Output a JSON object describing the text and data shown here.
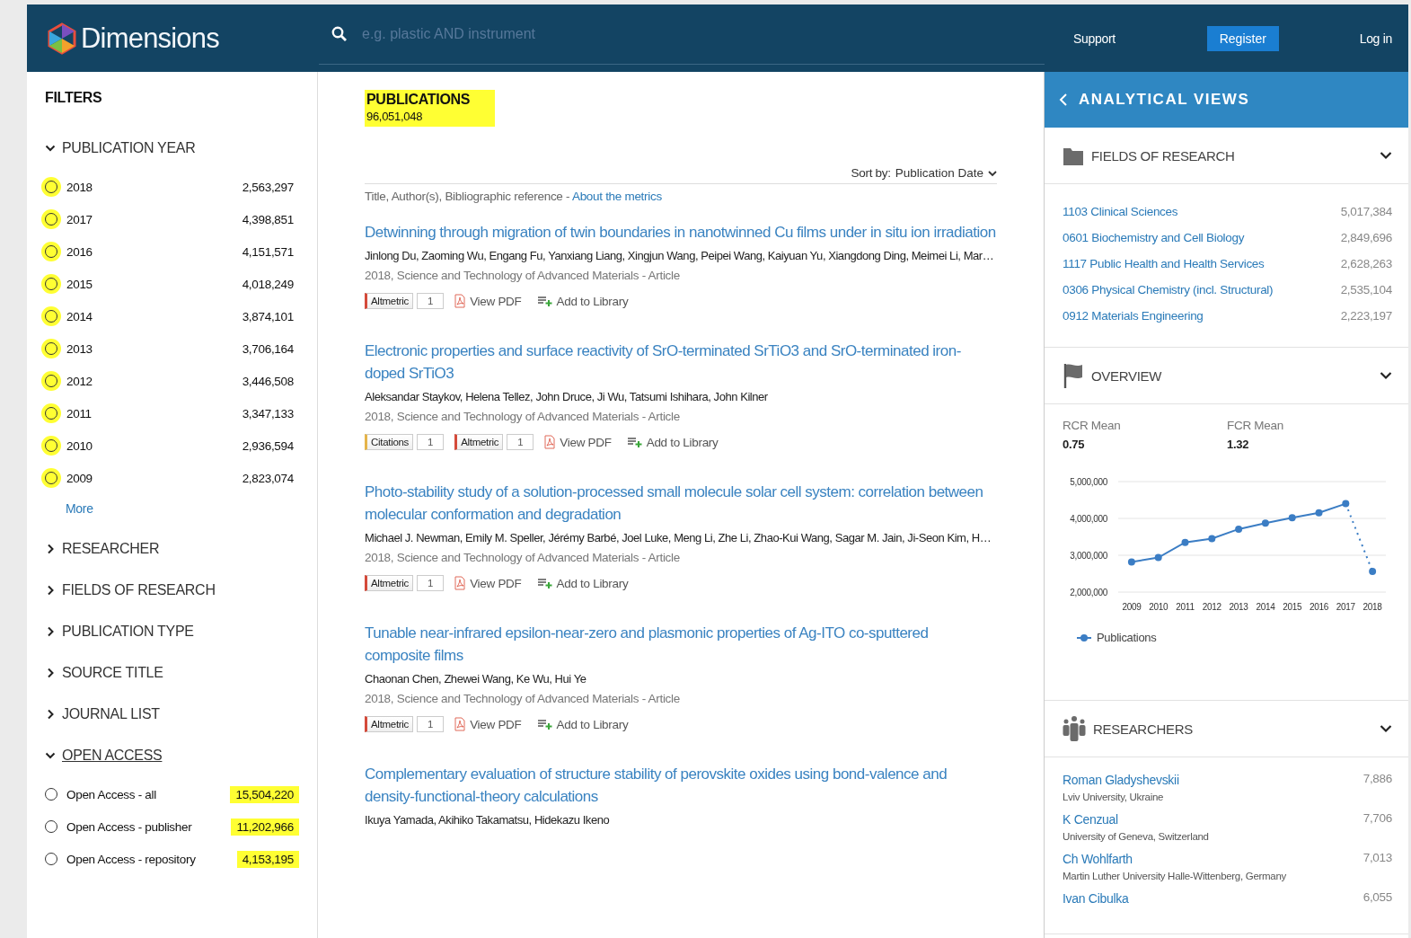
{
  "header": {
    "logo": "Dimensions",
    "search": {
      "placeholder": "e.g. plastic AND instrument"
    },
    "links": [
      {
        "label": "Support",
        "kind": "link"
      },
      {
        "label": "Register",
        "kind": "button"
      },
      {
        "label": "Log in",
        "kind": "link"
      }
    ]
  },
  "filters": {
    "title": "FILTERS",
    "sections": [
      {
        "label": "PUBLICATION YEAR",
        "expanded": true,
        "hovered": false,
        "more": "More",
        "options": [
          {
            "label": "2018",
            "count": "2,563,297",
            "selected": false,
            "radio_highlighted": true,
            "count_highlighted": false
          },
          {
            "label": "2017",
            "count": "4,398,851",
            "selected": false,
            "radio_highlighted": true,
            "count_highlighted": false
          },
          {
            "label": "2016",
            "count": "4,151,571",
            "selected": false,
            "radio_highlighted": true,
            "count_highlighted": false
          },
          {
            "label": "2015",
            "count": "4,018,249",
            "selected": false,
            "radio_highlighted": true,
            "count_highlighted": false
          },
          {
            "label": "2014",
            "count": "3,874,101",
            "selected": false,
            "radio_highlighted": true,
            "count_highlighted": false
          },
          {
            "label": "2013",
            "count": "3,706,164",
            "selected": false,
            "radio_highlighted": true,
            "count_highlighted": false
          },
          {
            "label": "2012",
            "count": "3,446,508",
            "selected": false,
            "radio_highlighted": true,
            "count_highlighted": false
          },
          {
            "label": "2011",
            "count": "3,347,133",
            "selected": false,
            "radio_highlighted": true,
            "count_highlighted": false
          },
          {
            "label": "2010",
            "count": "2,936,594",
            "selected": false,
            "radio_highlighted": true,
            "count_highlighted": false
          },
          {
            "label": "2009",
            "count": "2,823,074",
            "selected": false,
            "radio_highlighted": true,
            "count_highlighted": false
          }
        ]
      },
      {
        "label": "RESEARCHER",
        "expanded": false,
        "hovered": false
      },
      {
        "label": "FIELDS OF RESEARCH",
        "expanded": false,
        "hovered": false
      },
      {
        "label": "PUBLICATION TYPE",
        "expanded": false,
        "hovered": false
      },
      {
        "label": "SOURCE TITLE",
        "expanded": false,
        "hovered": false
      },
      {
        "label": "JOURNAL LIST",
        "expanded": false,
        "hovered": false
      },
      {
        "label": "OPEN ACCESS",
        "expanded": true,
        "hovered": true,
        "options": [
          {
            "label": "Open Access - all",
            "count": "15,504,220",
            "selected": false,
            "radio_highlighted": false,
            "count_highlighted": true
          },
          {
            "label": "Open Access - publisher",
            "count": "11,202,966",
            "selected": false,
            "radio_highlighted": false,
            "count_highlighted": true
          },
          {
            "label": "Open Access - repository",
            "count": "4,153,195",
            "selected": false,
            "radio_highlighted": false,
            "count_highlighted": true
          }
        ]
      }
    ]
  },
  "results": {
    "title": "PUBLICATIONS",
    "count": "96,051,048",
    "highlighted": true,
    "sort_label": "Sort by:",
    "sort_value": "Publication Date",
    "columns_note": "Title, Author(s), Bibliographic reference - ",
    "metrics_link": "About the metrics",
    "items": [
      {
        "title": "Detwinning through migration of twin boundaries in nanotwinned Cu films under in situ ion irradiation",
        "authors": "Jinlong Du, Zaoming Wu, Engang Fu, Yanxiang Liang, Xingjun Wang, Peipei Wang, Kaiyuan Yu, Xiangdong Ding, Meimei Li, Mar…",
        "meta": "2018, Science and Technology of Advanced Materials - Article",
        "metrics": [
          {
            "kind": "altmetric",
            "label": "Altmetric",
            "count": "1"
          }
        ],
        "pdf": "View PDF",
        "library": "Add to Library"
      },
      {
        "title": "Electronic properties and surface reactivity of SrO-terminated SrTiO3 and SrO-terminated iron-doped SrTiO3",
        "authors": "Aleksandar Staykov, Helena Tellez, John Druce, Ji Wu, Tatsumi Ishihara, John Kilner",
        "meta": "2018, Science and Technology of Advanced Materials - Article",
        "metrics": [
          {
            "kind": "citations",
            "label": "Citations",
            "count": "1"
          },
          {
            "kind": "altmetric",
            "label": "Altmetric",
            "count": "1"
          }
        ],
        "pdf": "View PDF",
        "library": "Add to Library"
      },
      {
        "title": "Photo-stability study of a solution-processed small molecule solar cell system: correlation between molecular conformation and degradation",
        "authors": "Michael J. Newman, Emily M. Speller, Jérémy Barbé, Joel Luke, Meng Li, Zhe Li, Zhao-Kui Wang, Sagar M. Jain, Ji-Seon Kim, H…",
        "meta": "2018, Science and Technology of Advanced Materials - Article",
        "metrics": [
          {
            "kind": "altmetric",
            "label": "Altmetric",
            "count": "1"
          }
        ],
        "pdf": "View PDF",
        "library": "Add to Library"
      },
      {
        "title": "Tunable near-infrared epsilon-near-zero and plasmonic properties of Ag-ITO co-sputtered composite films",
        "authors": "Chaonan Chen, Zhewei Wang, Ke Wu, Hui Ye",
        "meta": "2018, Science and Technology of Advanced Materials - Article",
        "metrics": [
          {
            "kind": "altmetric",
            "label": "Altmetric",
            "count": "1"
          }
        ],
        "pdf": "View PDF",
        "library": "Add to Library"
      },
      {
        "title": "Complementary evaluation of structure stability of perovskite oxides using bond-valence and density-functional-theory calculations",
        "authors": "Ikuya Yamada, Akihiko Takamatsu, Hidekazu Ikeno"
      }
    ]
  },
  "analytics": {
    "title": "ANALYTICAL VIEWS",
    "panels": [
      {
        "kind": "fields",
        "title": "FIELDS OF RESEARCH",
        "rows": [
          {
            "label": "1103 Clinical Sciences",
            "count": "5,017,384"
          },
          {
            "label": "0601 Biochemistry and Cell Biology",
            "count": "2,849,696"
          },
          {
            "label": "1117 Public Health and Health Services",
            "count": "2,628,263"
          },
          {
            "label": "0306 Physical Chemistry (incl. Structural)",
            "count": "2,535,104"
          },
          {
            "label": "0912 Materials Engineering",
            "count": "2,223,197"
          }
        ]
      },
      {
        "kind": "overview",
        "title": "OVERVIEW",
        "stats": [
          {
            "label": "RCR Mean",
            "value": "0.75"
          },
          {
            "label": "FCR Mean",
            "value": "1.32"
          }
        ],
        "chart_data": {
          "type": "line",
          "categories": [
            "2009",
            "2010",
            "2011",
            "2012",
            "2013",
            "2014",
            "2015",
            "2016",
            "2017",
            "2018"
          ],
          "series": [
            {
              "name": "Publications",
              "color": "#3b7dc4",
              "marker": "circle",
              "values": [
                2820000,
                2940000,
                3350000,
                3450000,
                3710000,
                3870000,
                4020000,
                4150000,
                4400000,
                2560000
              ]
            }
          ],
          "ylim": [
            2000000,
            5000000
          ],
          "yticks": [
            {
              "value": 2000000,
              "label": "2,000,000"
            },
            {
              "value": 3000000,
              "label": "3,000,000"
            },
            {
              "value": 4000000,
              "label": "4,000,000"
            },
            {
              "value": 5000000,
              "label": "5,000,000"
            }
          ]
        }
      },
      {
        "kind": "researchers",
        "title": "RESEARCHERS",
        "rows": [
          {
            "label": "Roman Gladyshevskii",
            "sub": "Lviv University, Ukraine",
            "count": "7,886"
          },
          {
            "label": "K Cenzual",
            "sub": "University of Geneva, Switzerland",
            "count": "7,706"
          },
          {
            "label": "Ch Wohlfarth",
            "sub": "Martin Luther University Halle-Wittenberg, Germany",
            "count": "7,013"
          },
          {
            "label": "Ivan Cibulka",
            "count": "6,055"
          }
        ]
      }
    ]
  }
}
